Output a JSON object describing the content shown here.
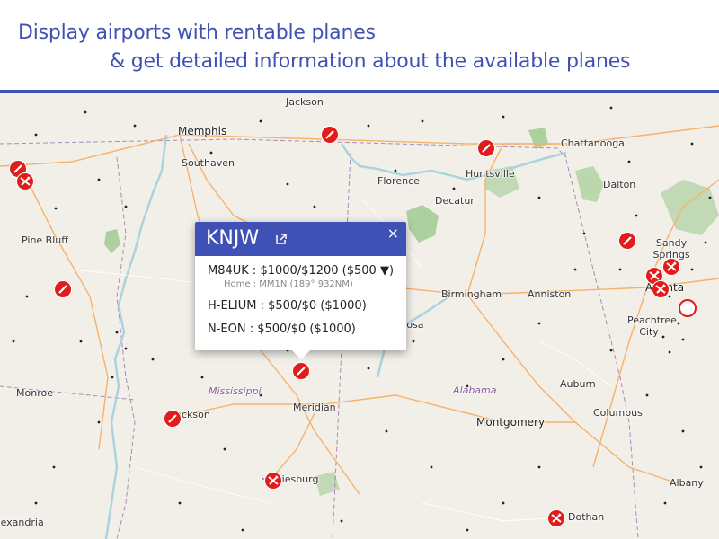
{
  "header": {
    "line1": "Display airports with rentable planes",
    "line2": "& get detailed information about the available planes"
  },
  "map": {
    "places": [
      {
        "name": "Jackson",
        "id": "jackson-tn"
      },
      {
        "name": "Memphis",
        "id": "memphis"
      },
      {
        "name": "Southaven",
        "id": "southaven"
      },
      {
        "name": "Chattanooga",
        "id": "chattanooga"
      },
      {
        "name": "Huntsville",
        "id": "huntsville"
      },
      {
        "name": "Florence",
        "id": "florence"
      },
      {
        "name": "Decatur",
        "id": "decatur"
      },
      {
        "name": "Dalton",
        "id": "dalton"
      },
      {
        "name": "Pine Bluff",
        "id": "pine-bluff"
      },
      {
        "name": "Sandy Springs",
        "id": "sandy-springs"
      },
      {
        "name": "Atlanta",
        "id": "atlanta"
      },
      {
        "name": "Birmingham",
        "id": "birmingham"
      },
      {
        "name": "Anniston",
        "id": "anniston"
      },
      {
        "name": "Peachtree City",
        "id": "peachtree-city"
      },
      {
        "name": "Tuscaloosa",
        "id": "tuscaloosa"
      },
      {
        "name": "Monroe",
        "id": "monroe"
      },
      {
        "name": "Mississippi",
        "id": "mississippi"
      },
      {
        "name": "Jackson",
        "id": "jackson-ms"
      },
      {
        "name": "Meridian",
        "id": "meridian"
      },
      {
        "name": "Alabama",
        "id": "alabama"
      },
      {
        "name": "Auburn",
        "id": "auburn"
      },
      {
        "name": "Montgomery",
        "id": "montgomery"
      },
      {
        "name": "Columbus",
        "id": "columbus"
      },
      {
        "name": "Hattiesburg",
        "id": "hattiesburg"
      },
      {
        "name": "Albany",
        "id": "albany"
      },
      {
        "name": "Dothan",
        "id": "dothan"
      },
      {
        "name": "Alexandria",
        "id": "alexandria"
      }
    ]
  },
  "popup": {
    "title": "KNJW",
    "close": "×",
    "rows": [
      {
        "text": "M84UK : $1000/$1200 ($500 ▼)",
        "sub": "Home : MM1N (189° 932NM)"
      },
      {
        "text": "H-ELIUM : $500/$0 ($1000)"
      },
      {
        "text": "N-EON : $500/$0 ($1000)"
      }
    ]
  },
  "colors": {
    "brand": "#3f51b5",
    "marker": "#e21b1b",
    "land": "#f2efe9",
    "road": "#f6b26b",
    "river": "#aad3df",
    "forest": "#add19e"
  },
  "icons": {
    "popup_link": "external-link-icon",
    "marker_parked": "slash-icon",
    "marker_plane": "plane-icon"
  }
}
